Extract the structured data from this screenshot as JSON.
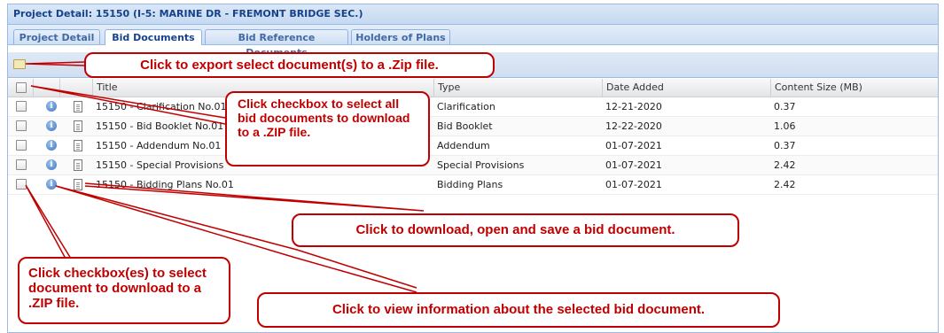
{
  "window": {
    "title": "Project Detail: 15150 (I-5: MARINE DR - FREMONT BRIDGE SEC.)"
  },
  "tabs": [
    {
      "label": "Project Detail",
      "active": false
    },
    {
      "label": "Bid Documents",
      "active": true
    },
    {
      "label": "Bid Reference Documents",
      "active": false
    },
    {
      "label": "Holders of Plans",
      "active": false
    }
  ],
  "toolbar": {
    "export_icon": "zip-folder-icon"
  },
  "grid": {
    "columns": [
      "Title",
      "Type",
      "Date Added",
      "Content Size (MB)"
    ],
    "rows": [
      {
        "title": "15150 - Clarification No.01",
        "type": "Clarification",
        "date": "12-21-2020",
        "size": "0.37"
      },
      {
        "title": "15150 - Bid Booklet No.01",
        "type": "Bid Booklet",
        "date": "12-22-2020",
        "size": "1.06"
      },
      {
        "title": "15150 - Addendum No.01",
        "type": "Addendum",
        "date": "01-07-2021",
        "size": "0.37"
      },
      {
        "title": "15150 - Special Provisions",
        "type": "Special Provisions",
        "date": "01-07-2021",
        "size": "2.42"
      },
      {
        "title": "15150 - Bidding Plans No.01",
        "type": "Bidding Plans",
        "date": "01-07-2021",
        "size": "2.42"
      }
    ]
  },
  "callouts": {
    "export": "Click to export select document(s) to a .Zip file.",
    "select_all": "Click checkbox to select all bid docouments to download to a .ZIP file.",
    "download": "Click to download, open and save a bid document.",
    "select_some": "Click checkbox(es) to select document to download to a .ZIP file.",
    "info": "Click to view information about the selected bid document."
  },
  "colors": {
    "callout": "#c00000",
    "header_text": "#15428b",
    "border": "#99bbe8"
  }
}
